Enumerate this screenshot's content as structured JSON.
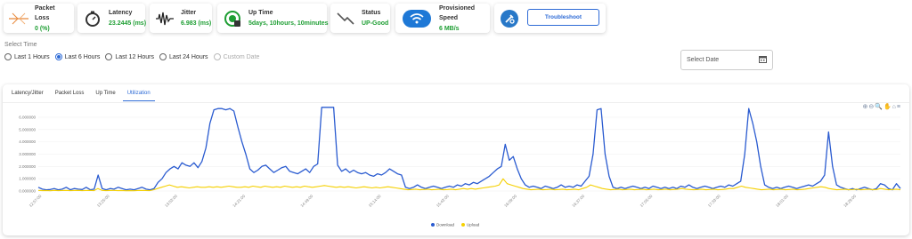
{
  "metrics": [
    {
      "label": "Packet Loss",
      "value": "0 (%)",
      "icon": "packet-loss-icon"
    },
    {
      "label": "Latency",
      "value": "23.2445 (ms)",
      "icon": "latency-icon"
    },
    {
      "label": "Jitter",
      "value": "6.983 (ms)",
      "icon": "jitter-icon"
    },
    {
      "label": "Up Time",
      "value": "5days, 10hours, 10minutes",
      "icon": "uptime-icon"
    },
    {
      "label": "Status",
      "value": "UP-Good",
      "icon": "status-icon"
    },
    {
      "label": "Provisioned Speed",
      "value": "6 MB/s",
      "icon": "wifi-icon"
    }
  ],
  "troubleshoot": {
    "label": "Troubleshoot"
  },
  "select_time": {
    "label": "Select Time",
    "options": [
      "Last 1 Hours",
      "Last 6 Hours",
      "Last 12 Hours",
      "Last 24 Hours",
      "Custom Date"
    ],
    "selected": "Last 6 Hours"
  },
  "date_picker": {
    "placeholder": "Select Date"
  },
  "tabs": [
    "Latency/Jitter",
    "Packet Loss",
    "Up Time",
    "Utilization"
  ],
  "active_tab": "Utilization",
  "colors": {
    "accent": "#2e6bd6",
    "download": "#2a5bd0",
    "upload": "#f5d000",
    "ok": "#1e9e33"
  },
  "chart_data": {
    "type": "line",
    "yticks": [
      "0.000000",
      "1.000000",
      "2.000000",
      "3.000000",
      "4.000000",
      "5.000000",
      "6.000000"
    ],
    "ylim": [
      0,
      6.5
    ],
    "xticks": [
      "12:57:00",
      "13:25:00",
      "13:53:00",
      "14:21:00",
      "14:49:00",
      "15:14:00",
      "15:43:00",
      "16:09:00",
      "16:37:00",
      "17:05:00",
      "17:33:00",
      "18:01:00",
      "18:29:00"
    ],
    "legend": [
      "Download",
      "Upload"
    ],
    "series": [
      {
        "name": "Download",
        "values": [
          0.3,
          0.15,
          0.1,
          0.12,
          0.2,
          0.1,
          0.15,
          0.3,
          0.1,
          0.2,
          0.15,
          0.12,
          0.3,
          0.1,
          0.15,
          1.3,
          0.2,
          0.1,
          0.2,
          0.15,
          0.3,
          0.2,
          0.1,
          0.15,
          0.1,
          0.2,
          0.3,
          0.15,
          0.1,
          0.2,
          0.7,
          1.0,
          1.5,
          1.8,
          2.0,
          1.8,
          2.3,
          2.1,
          2.0,
          2.3,
          1.9,
          2.4,
          3.5,
          5.5,
          6.6,
          6.7,
          6.7,
          6.6,
          6.7,
          6.5,
          5.2,
          4.0,
          3.0,
          1.8,
          1.5,
          1.7,
          2.0,
          2.1,
          1.8,
          1.5,
          1.7,
          1.9,
          2.0,
          1.6,
          1.5,
          1.4,
          1.6,
          1.8,
          1.5,
          2.0,
          2.2,
          6.8,
          6.8,
          6.8,
          6.8,
          2.1,
          1.6,
          1.8,
          1.5,
          1.7,
          1.5,
          1.4,
          1.5,
          1.3,
          1.2,
          1.4,
          1.3,
          1.5,
          1.8,
          1.6,
          1.4,
          1.3,
          0.3,
          0.2,
          0.3,
          0.5,
          0.3,
          0.2,
          0.3,
          0.4,
          0.3,
          0.2,
          0.3,
          0.4,
          0.3,
          0.5,
          0.4,
          0.6,
          0.5,
          0.7,
          0.6,
          0.8,
          1.0,
          1.2,
          1.5,
          1.8,
          2.0,
          3.8,
          2.5,
          2.8,
          1.8,
          1.0,
          0.5,
          0.3,
          0.4,
          0.3,
          0.2,
          0.4,
          0.3,
          0.2,
          0.3,
          0.5,
          0.3,
          0.4,
          0.3,
          0.5,
          0.4,
          0.8,
          1.2,
          3.0,
          6.6,
          6.7,
          3.0,
          1.2,
          0.3,
          0.2,
          0.3,
          0.2,
          0.3,
          0.4,
          0.3,
          0.2,
          0.3,
          0.2,
          0.4,
          0.3,
          0.2,
          0.3,
          0.2,
          0.3,
          0.2,
          0.4,
          0.3,
          0.5,
          0.3,
          0.2,
          0.3,
          0.4,
          0.3,
          0.2,
          0.3,
          0.4,
          0.3,
          0.5,
          0.4,
          0.6,
          0.8,
          3.0,
          6.7,
          5.5,
          4.0,
          2.0,
          0.5,
          0.3,
          0.2,
          0.3,
          0.2,
          0.3,
          0.4,
          0.3,
          0.2,
          0.3,
          0.4,
          0.5,
          0.4,
          0.6,
          0.8,
          1.3,
          4.8,
          2.0,
          0.5,
          0.3,
          0.2,
          0.1,
          0.2,
          0.1,
          0.2,
          0.3,
          0.2,
          0.1,
          0.2,
          0.6,
          0.5,
          0.2,
          0.1,
          0.6,
          0.2
        ]
      },
      {
        "name": "Upload",
        "values": [
          0.05,
          0.03,
          0.04,
          0.02,
          0.05,
          0.03,
          0.04,
          0.05,
          0.03,
          0.04,
          0.05,
          0.03,
          0.04,
          0.05,
          0.03,
          0.2,
          0.05,
          0.03,
          0.04,
          0.05,
          0.03,
          0.04,
          0.02,
          0.03,
          0.02,
          0.04,
          0.05,
          0.04,
          0.03,
          0.1,
          0.2,
          0.3,
          0.4,
          0.5,
          0.4,
          0.3,
          0.35,
          0.3,
          0.25,
          0.3,
          0.35,
          0.3,
          0.3,
          0.35,
          0.3,
          0.35,
          0.3,
          0.35,
          0.4,
          0.35,
          0.3,
          0.3,
          0.35,
          0.3,
          0.4,
          0.35,
          0.3,
          0.4,
          0.35,
          0.3,
          0.35,
          0.3,
          0.4,
          0.35,
          0.3,
          0.35,
          0.3,
          0.4,
          0.35,
          0.3,
          0.35,
          0.4,
          0.45,
          0.4,
          0.35,
          0.3,
          0.35,
          0.3,
          0.35,
          0.3,
          0.25,
          0.3,
          0.35,
          0.3,
          0.25,
          0.3,
          0.25,
          0.3,
          0.35,
          0.3,
          0.25,
          0.2,
          0.15,
          0.1,
          0.12,
          0.15,
          0.1,
          0.12,
          0.15,
          0.1,
          0.12,
          0.15,
          0.1,
          0.12,
          0.15,
          0.1,
          0.15,
          0.2,
          0.15,
          0.2,
          0.15,
          0.2,
          0.25,
          0.3,
          0.35,
          0.4,
          0.5,
          1.0,
          0.6,
          0.5,
          0.4,
          0.3,
          0.2,
          0.15,
          0.1,
          0.12,
          0.15,
          0.1,
          0.12,
          0.15,
          0.1,
          0.12,
          0.15,
          0.1,
          0.12,
          0.15,
          0.1,
          0.2,
          0.3,
          0.5,
          0.4,
          0.3,
          0.2,
          0.15,
          0.1,
          0.12,
          0.15,
          0.1,
          0.12,
          0.15,
          0.1,
          0.12,
          0.15,
          0.1,
          0.12,
          0.15,
          0.1,
          0.12,
          0.15,
          0.1,
          0.12,
          0.15,
          0.2,
          0.15,
          0.12,
          0.1,
          0.12,
          0.15,
          0.1,
          0.12,
          0.15,
          0.1,
          0.12,
          0.15,
          0.2,
          0.2,
          0.3,
          0.4,
          0.3,
          0.25,
          0.2,
          0.15,
          0.1,
          0.12,
          0.15,
          0.1,
          0.12,
          0.15,
          0.1,
          0.12,
          0.15,
          0.1,
          0.12,
          0.15,
          0.2,
          0.25,
          0.3,
          0.35,
          0.3,
          0.2,
          0.15,
          0.1,
          0.12,
          0.15,
          0.1,
          0.12,
          0.15,
          0.1,
          0.12,
          0.15,
          0.1,
          0.12,
          0.2,
          0.15,
          0.1,
          0.12,
          0.15,
          0.1
        ]
      }
    ]
  }
}
